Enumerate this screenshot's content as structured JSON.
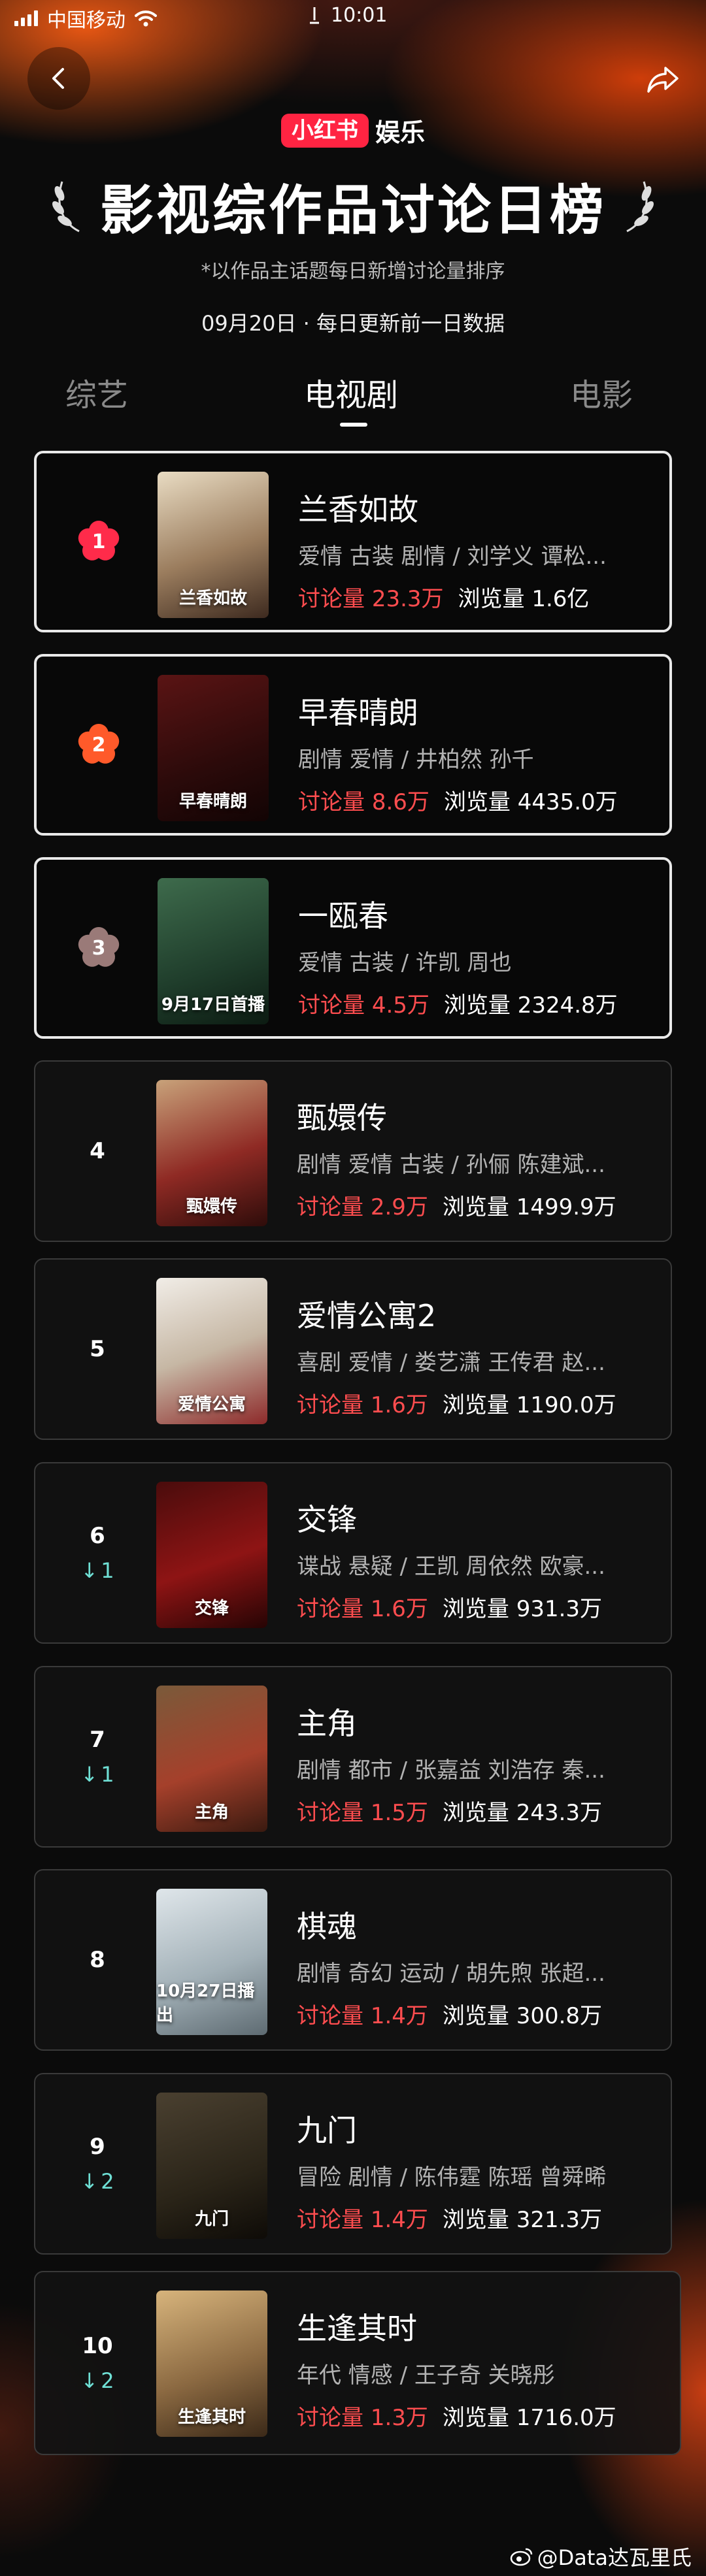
{
  "status_bar": {
    "carrier": "中国移动",
    "time": "10:01"
  },
  "brand": {
    "logo": "小红书",
    "text": "娱乐"
  },
  "page_title": "影视综作品讨论日榜",
  "subtitle": "*以作品主话题每日新增讨论量排序",
  "date_line": "09月20日 · 每日更新前一日数据",
  "tabs": [
    {
      "label": "综艺",
      "active": false
    },
    {
      "label": "电视剧",
      "active": true
    },
    {
      "label": "电影",
      "active": false
    }
  ],
  "colors": {
    "accent": "#ff4d4f",
    "brand": "#ff2442",
    "rank_change": "#6fe0d5"
  },
  "list": [
    {
      "rank": "1",
      "change": "",
      "title": "兰香如故",
      "tags": "爱情 古装 剧情 / 刘学义 谭松...",
      "discuss_label": "讨论量",
      "discuss": "23.3万",
      "views_label": "浏览量",
      "views": "1.6亿",
      "poster_text": "兰香如故"
    },
    {
      "rank": "2",
      "change": "",
      "title": "早春晴朗",
      "tags": "剧情 爱情 / 井柏然 孙千",
      "discuss_label": "讨论量",
      "discuss": "8.6万",
      "views_label": "浏览量",
      "views": "4435.0万",
      "poster_text": "早春晴朗"
    },
    {
      "rank": "3",
      "change": "",
      "title": "一瓯春",
      "tags": "爱情 古装 / 许凯 周也",
      "discuss_label": "讨论量",
      "discuss": "4.5万",
      "views_label": "浏览量",
      "views": "2324.8万",
      "poster_text": "9月17日首播"
    },
    {
      "rank": "4",
      "change": "",
      "title": "甄嬛传",
      "tags": "剧情 爱情 古装 / 孙俪 陈建斌...",
      "discuss_label": "讨论量",
      "discuss": "2.9万",
      "views_label": "浏览量",
      "views": "1499.9万",
      "poster_text": "甄嬛传"
    },
    {
      "rank": "5",
      "change": "",
      "title": "爱情公寓2",
      "tags": "喜剧 爱情 / 娄艺潇 王传君 赵...",
      "discuss_label": "讨论量",
      "discuss": "1.6万",
      "views_label": "浏览量",
      "views": "1190.0万",
      "poster_text": "爱情公寓"
    },
    {
      "rank": "6",
      "change": "1",
      "title": "交锋",
      "tags": "谍战 悬疑 / 王凯 周依然 欧豪...",
      "discuss_label": "讨论量",
      "discuss": "1.6万",
      "views_label": "浏览量",
      "views": "931.3万",
      "poster_text": "交锋"
    },
    {
      "rank": "7",
      "change": "1",
      "title": "主角",
      "tags": "剧情 都市 / 张嘉益 刘浩存 秦...",
      "discuss_label": "讨论量",
      "discuss": "1.5万",
      "views_label": "浏览量",
      "views": "243.3万",
      "poster_text": "主角"
    },
    {
      "rank": "8",
      "change": "",
      "title": "棋魂",
      "tags": "剧情 奇幻 运动 / 胡先煦 张超...",
      "discuss_label": "讨论量",
      "discuss": "1.4万",
      "views_label": "浏览量",
      "views": "300.8万",
      "poster_text": "10月27日播出"
    },
    {
      "rank": "9",
      "change": "2",
      "title": "九门",
      "tags": "冒险 剧情 / 陈伟霆 陈瑶 曾舜晞",
      "discuss_label": "讨论量",
      "discuss": "1.4万",
      "views_label": "浏览量",
      "views": "321.3万",
      "poster_text": "九门"
    },
    {
      "rank": "10",
      "change": "2",
      "title": "生逢其时",
      "tags": "年代 情感 / 王子奇 关晓彤",
      "discuss_label": "讨论量",
      "discuss": "1.3万",
      "views_label": "浏览量",
      "views": "1716.0万",
      "poster_text": "生逢其时"
    }
  ],
  "watermark": "@Data达瓦里氏"
}
